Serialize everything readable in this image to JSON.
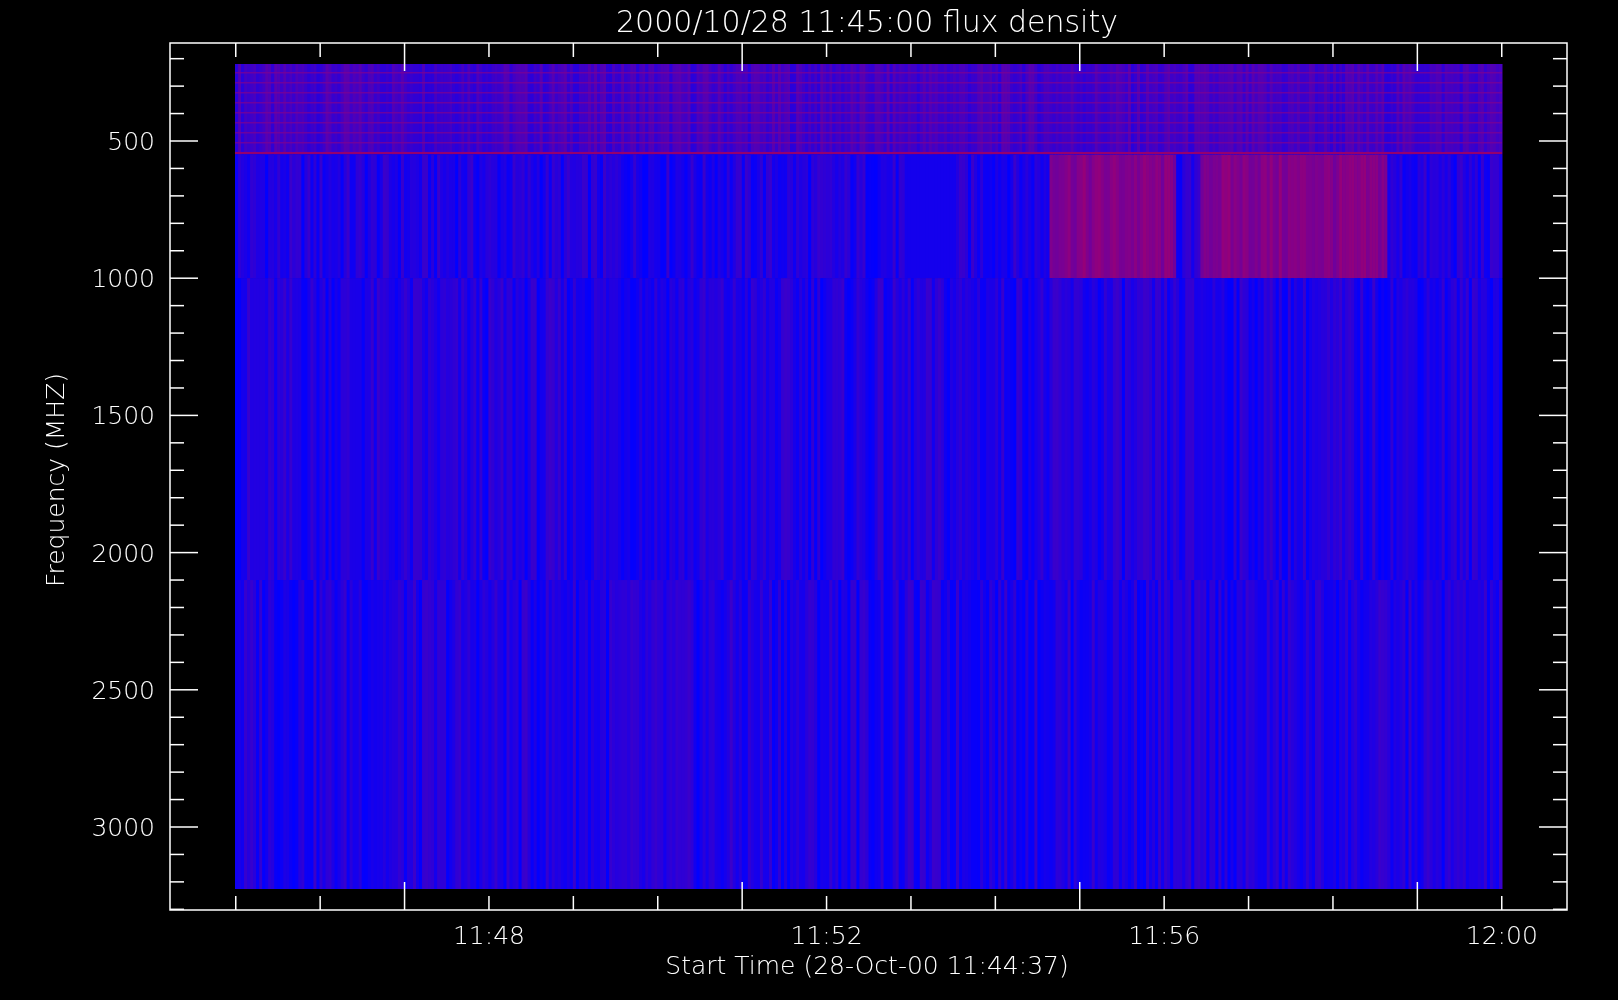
{
  "title": "2000/10/28 11:45:00 flux density",
  "y_axis": {
    "label": "Frequency (MHZ)",
    "ticks": [
      "500",
      "1000",
      "1500",
      "2000",
      "2500",
      "3000"
    ]
  },
  "x_axis": {
    "label": "Start Time (28-Oct-00 11:44:37)",
    "ticks": [
      "11:48",
      "11:52",
      "11:56",
      "12:00"
    ]
  }
}
